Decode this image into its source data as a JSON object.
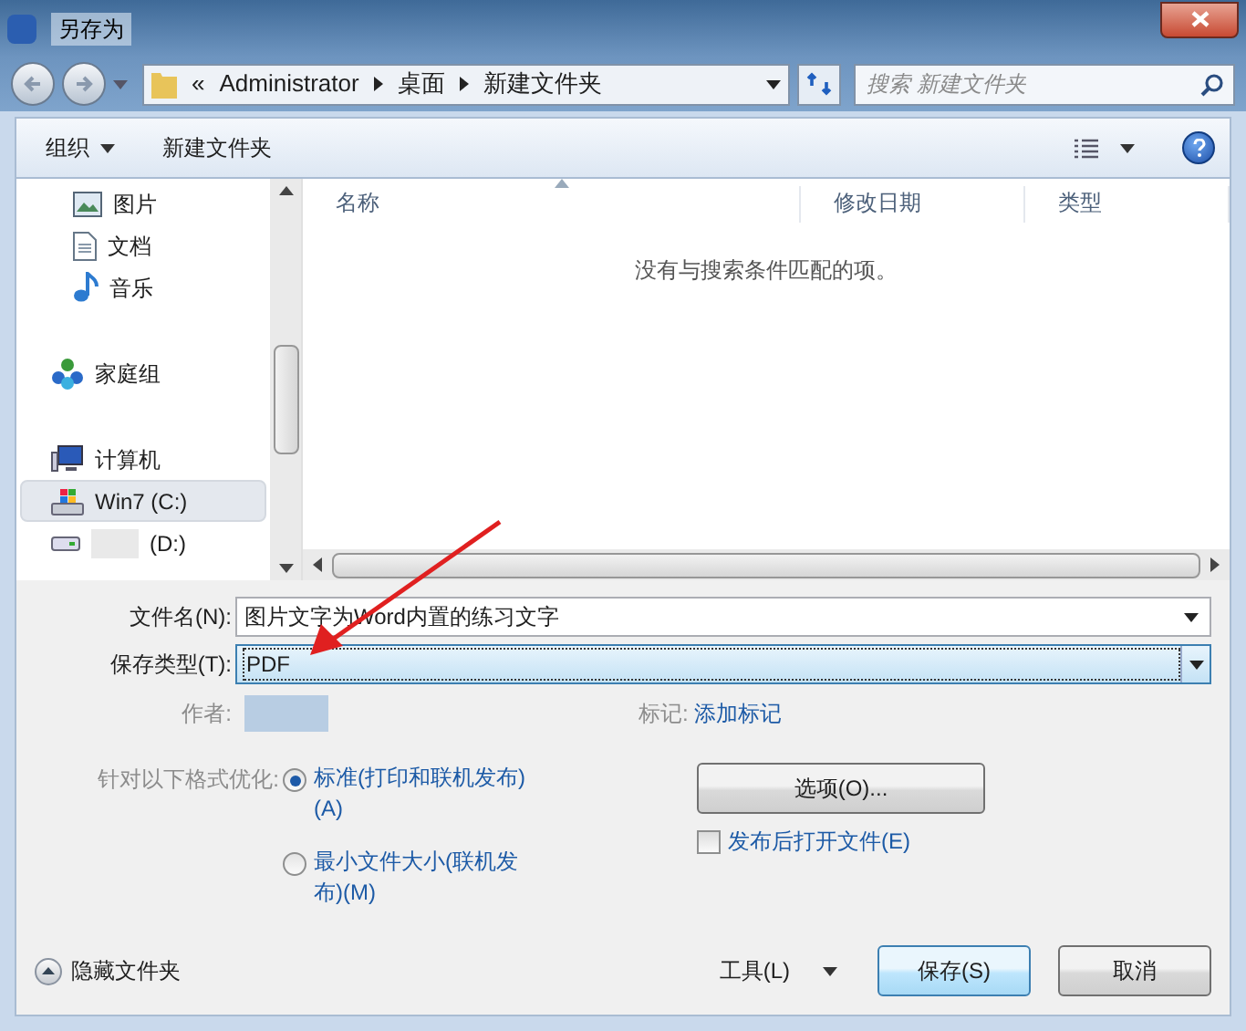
{
  "window": {
    "title": "另存为"
  },
  "address": {
    "overflow": "«",
    "path": [
      "Administrator",
      "桌面",
      "新建文件夹"
    ]
  },
  "search": {
    "placeholder": "搜索 新建文件夹"
  },
  "toolbar": {
    "organize": "组织",
    "new_folder": "新建文件夹"
  },
  "nav": [
    {
      "children": [
        {
          "label": "图片",
          "kind": "pictures",
          "selected": false
        },
        {
          "label": "文档",
          "kind": "documents",
          "selected": false
        },
        {
          "label": "音乐",
          "kind": "music",
          "selected": false
        }
      ]
    },
    {
      "label": "家庭组",
      "kind": "homegroup",
      "selected": false
    },
    {
      "label": "计算机",
      "kind": "computer",
      "selected": false,
      "children": [
        {
          "label": "Win7 (C:)",
          "kind": "system-drive",
          "selected": true
        },
        {
          "label": "(D:)",
          "kind": "drive",
          "selected": false
        }
      ]
    }
  ],
  "columns": [
    "名称",
    "修改日期",
    "类型"
  ],
  "empty_message": "没有与搜索条件匹配的项。",
  "form": {
    "filename_label": "文件名(N):",
    "filename": "图片文字为Word内置的练习文字",
    "type_label": "保存类型(T):",
    "type": "PDF",
    "author_label": "作者:",
    "tags_label": "标记:",
    "tags_link": "添加标记"
  },
  "optimize": {
    "label": "针对以下格式优化:",
    "options": [
      {
        "label": "标准(打印和联机发布)(A)",
        "selected": true
      },
      {
        "label": "最小文件大小(联机发布)(M)",
        "selected": false
      }
    ]
  },
  "options_button": "选项(O)...",
  "open_after": {
    "label": "发布后打开文件(E)",
    "checked": false
  },
  "hide_folders": "隐藏文件夹",
  "tools": "工具(L)",
  "save": "保存(S)",
  "cancel": "取消"
}
